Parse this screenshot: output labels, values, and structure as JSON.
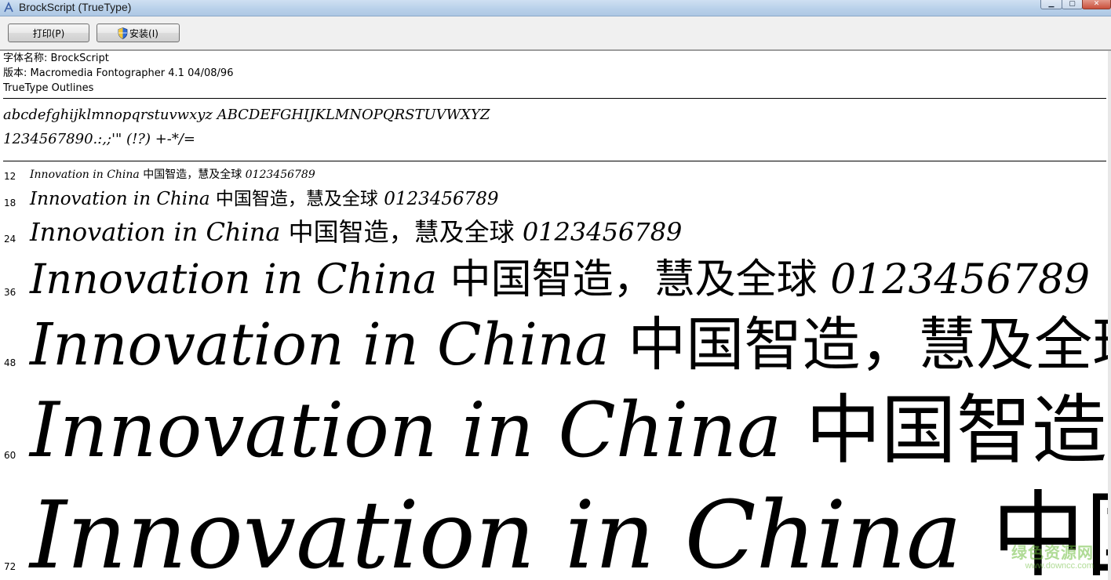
{
  "window": {
    "title": "BrockScript (TrueType)"
  },
  "toolbar": {
    "print_label": "打印(P)",
    "install_label": "安装(I)"
  },
  "font_info": {
    "name_line": "字体名称: BrockScript",
    "version_line": "版本: Macromedia Fontographer 4.1 04/08/96",
    "type_line": "TrueType Outlines"
  },
  "charset": {
    "letters": "abcdefghijklmnopqrstuvwxyz ABCDEFGHIJKLMNOPQRSTUVWXYZ",
    "symbols": "1234567890.:,;'\" (!?) +-*/="
  },
  "sample": {
    "latin": "Innovation in China",
    "cjk": "中国智造，慧及全球",
    "digits": "0123456789"
  },
  "sizes": [
    {
      "label": "12",
      "size": 12
    },
    {
      "label": "18",
      "size": 18
    },
    {
      "label": "24",
      "size": 24
    },
    {
      "label": "36",
      "size": 36
    },
    {
      "label": "48",
      "size": 48
    },
    {
      "label": "60",
      "size": 60
    },
    {
      "label": "72",
      "size": 72
    }
  ],
  "watermark": {
    "title": "绿色资源网",
    "url": "www.downcc.com"
  }
}
